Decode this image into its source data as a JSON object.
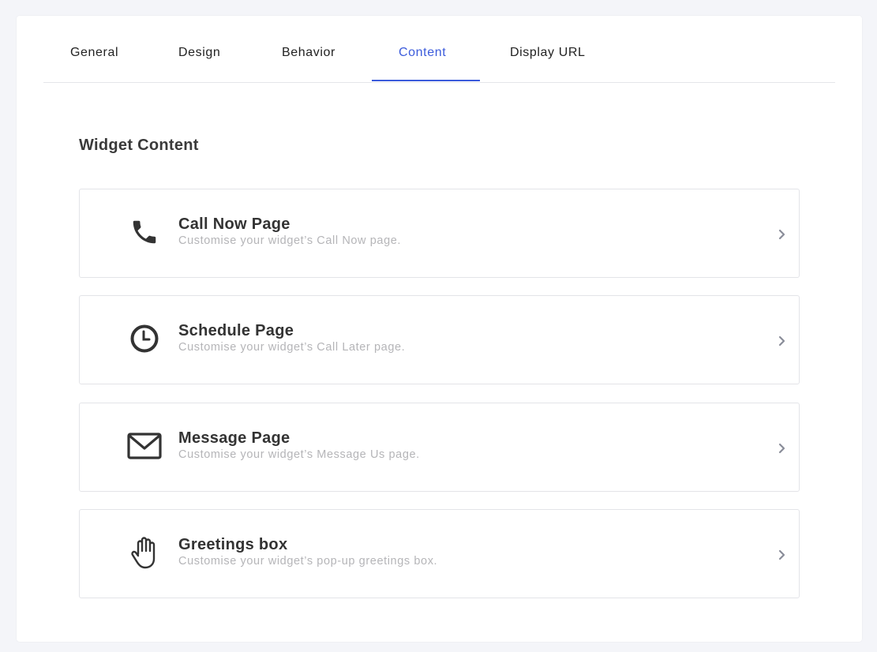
{
  "tabs": [
    {
      "label": "General"
    },
    {
      "label": "Design"
    },
    {
      "label": "Behavior"
    },
    {
      "label": "Content"
    },
    {
      "label": "Display URL"
    }
  ],
  "active_tab": "Content",
  "colors": {
    "accent": "#3b5bdb",
    "icon": "#333333",
    "chevron": "#8a8d99",
    "muted_text": "#b5b5b8"
  },
  "section": {
    "title": "Widget Content"
  },
  "cards": [
    {
      "icon": "phone-icon",
      "title": "Call Now Page",
      "desc": "Customise your widget’s Call Now page."
    },
    {
      "icon": "clock-icon",
      "title": "Schedule Page",
      "desc": "Customise your widget’s Call Later page."
    },
    {
      "icon": "envelope-icon",
      "title": "Message Page",
      "desc": "Customise your widget’s Message Us page."
    },
    {
      "icon": "hand-icon",
      "title": "Greetings box",
      "desc": "Customise your widget’s pop-up greetings box."
    }
  ]
}
